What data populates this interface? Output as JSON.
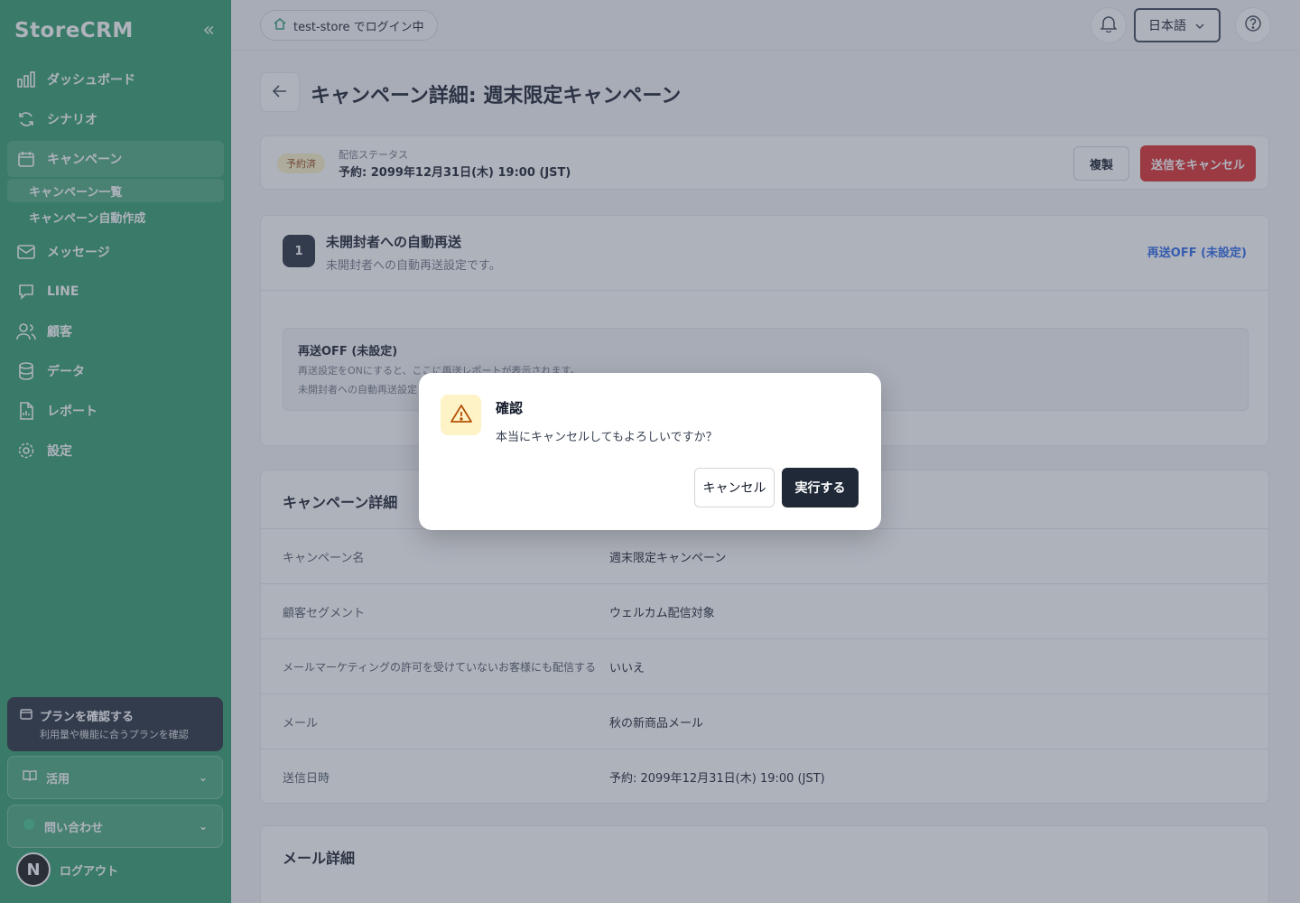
{
  "app": {
    "logo": "StoreCRM",
    "collapse_glyph": "«"
  },
  "sidebar": {
    "items": [
      {
        "label": "ダッシュボード",
        "icon": "bar-chart-icon"
      },
      {
        "label": "シナリオ",
        "icon": "refresh-icon"
      },
      {
        "label": "キャンペーン",
        "icon": "calendar-icon"
      },
      {
        "label": "メッセージ",
        "icon": "mail-icon"
      },
      {
        "label": "LINE",
        "icon": "chat-icon"
      },
      {
        "label": "顧客",
        "icon": "users-icon"
      },
      {
        "label": "データ",
        "icon": "database-icon"
      },
      {
        "label": "レポート",
        "icon": "report-icon"
      },
      {
        "label": "設定",
        "icon": "gear-icon"
      }
    ],
    "campaign_sub": [
      "キャンペーン一覧",
      "キャンペーン自動作成"
    ],
    "plan": {
      "title": "プランを確認する",
      "subtitle": "利用量や機能に合うプランを確認"
    },
    "accordion_use": "活用",
    "accordion_contact": "問い合わせ",
    "logout": "ログアウト",
    "n_badge": "N"
  },
  "header": {
    "login_status": "test-store でログイン中",
    "language": "日本語"
  },
  "page": {
    "title": "キャンペーン詳細: 週末限定キャンペーン",
    "status_badge": "予約済",
    "status_label": "配信ステータス",
    "status_value": "予約: 2099年12月31日(木) 19:00 (JST)",
    "copy_button": "複製",
    "cancel_send_button": "送信をキャンセル"
  },
  "resend": {
    "step": "1",
    "title": "未開封者への自動再送",
    "description": "未開封者への自動再送設定です。",
    "status": "再送OFF (未設定)",
    "inner_title": "再送OFF (未設定)",
    "inner_line1": "再送設定をONにすると、ここに再送レポートが表示されます。",
    "inner_line2": "未開封者への自動再送設定"
  },
  "details": {
    "title": "キャンペーン詳細",
    "rows": [
      {
        "label": "キャンペーン名",
        "value": "週末限定キャンペーン"
      },
      {
        "label": "顧客セグメント",
        "value": "ウェルカム配信対象"
      },
      {
        "label": "メールマーケティングの許可を受けていないお客様にも配信する",
        "value": "いいえ"
      },
      {
        "label": "メール",
        "value": "秋の新商品メール"
      },
      {
        "label": "送信日時",
        "value": "予約: 2099年12月31日(木) 19:00 (JST)"
      }
    ]
  },
  "mail_details": {
    "title": "メール詳細"
  },
  "modal": {
    "title": "確認",
    "message": "本当にキャンセルしてもよろしいですか？",
    "cancel_label": "キャンセル",
    "execute_label": "実行する"
  },
  "colors": {
    "sidebar_bg": "#2a9a68",
    "danger": "#dc2626",
    "dark": "#1f2937",
    "link": "#2563eb",
    "warning_bg": "#fef3c7"
  }
}
